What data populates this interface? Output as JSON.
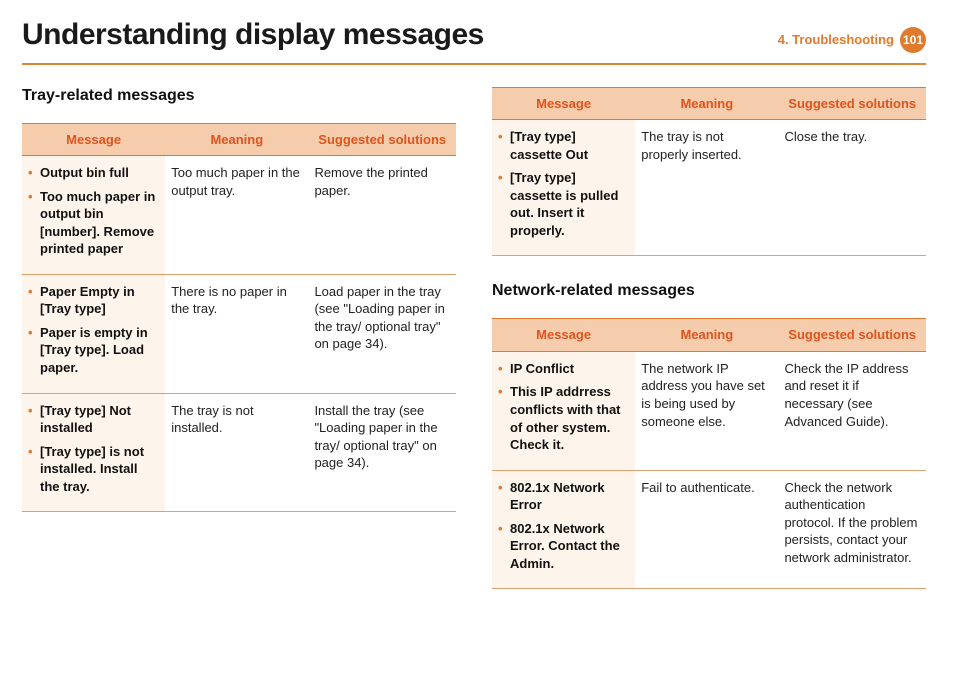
{
  "header": {
    "title": "Understanding display messages",
    "chapter": "4.  Troubleshooting",
    "page": "101"
  },
  "left": {
    "section_title": "Tray-related messages",
    "cols": {
      "c1": "Message",
      "c2": "Meaning",
      "c3": "Suggested solutions"
    },
    "rows": [
      {
        "messages": [
          "Output bin full",
          "Too much paper in output bin [number]. Remove printed paper"
        ],
        "meaning": "Too much paper in the output tray.",
        "solution": "Remove the printed paper."
      },
      {
        "messages": [
          "Paper Empty in [Tray type]",
          "Paper is empty in [Tray type]. Load paper."
        ],
        "meaning": "There is no paper in the tray.",
        "solution": "Load paper in the tray (see \"Loading paper in the tray/ optional tray\" on page 34)."
      },
      {
        "messages": [
          "[Tray type] Not installed",
          "[Tray type] is not installed. Install the tray."
        ],
        "meaning": "The tray is not installed.",
        "solution": "Install the tray (see \"Loading paper in the tray/ optional tray\" on page 34)."
      }
    ]
  },
  "rightTop": {
    "cols": {
      "c1": "Message",
      "c2": "Meaning",
      "c3": "Suggested solutions"
    },
    "rows": [
      {
        "messages": [
          "[Tray type] cassette Out",
          "[Tray type] cassette is pulled out. Insert it properly."
        ],
        "meaning": "The tray is not properly inserted.",
        "solution": "Close the tray."
      }
    ]
  },
  "rightBottom": {
    "section_title": "Network-related messages",
    "cols": {
      "c1": "Message",
      "c2": "Meaning",
      "c3": "Suggested solutions"
    },
    "rows": [
      {
        "messages": [
          "IP Conflict",
          "This IP addrress conflicts with that of other system. Check it."
        ],
        "meaning": "The network IP address you have set is being used by someone else.",
        "solution": "Check the IP address and reset it if necessary (see Advanced Guide)."
      },
      {
        "messages": [
          "802.1x Network Error",
          "802.1x Network Error. Contact the Admin."
        ],
        "meaning": "Fail to authenticate.",
        "solution": "Check the network authentication protocol. If the problem persists, contact your network administrator."
      }
    ]
  }
}
